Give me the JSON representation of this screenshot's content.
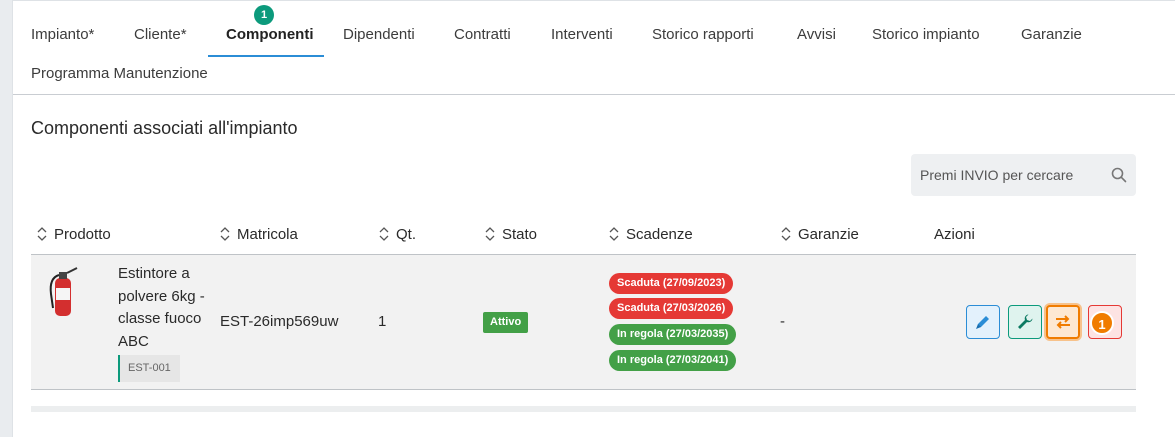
{
  "tabs": [
    {
      "label": "Impianto*"
    },
    {
      "label": "Cliente*"
    },
    {
      "label": "Componenti",
      "badge": "1"
    },
    {
      "label": "Dipendenti"
    },
    {
      "label": "Contratti"
    },
    {
      "label": "Interventi"
    },
    {
      "label": "Storico rapporti"
    },
    {
      "label": "Avvisi"
    },
    {
      "label": "Storico impianto"
    },
    {
      "label": "Garanzie"
    },
    {
      "label": "Programma Manutenzione"
    }
  ],
  "section_title": "Componenti associati all'impianto",
  "search": {
    "placeholder": "Premi INVIO per cercare"
  },
  "columns": [
    "Prodotto",
    "Matricola",
    "Qt.",
    "Stato",
    "Scadenze",
    "Garanzie",
    "Azioni"
  ],
  "rows": [
    {
      "product_name": "Estintore a polvere 6kg - classe fuoco ABC",
      "product_code": "EST-001",
      "matricola": "EST-26imp569uw",
      "qty": "1",
      "status": "Attivo",
      "scadenze": [
        {
          "text": "Scaduta (27/09/2023)",
          "color": "#e53935"
        },
        {
          "text": "Scaduta (27/03/2026)",
          "color": "#e53935"
        },
        {
          "text": "In regola (27/03/2035)",
          "color": "#43a047"
        },
        {
          "text": "In regola (27/03/2041)",
          "color": "#43a047"
        }
      ],
      "garanzie": "-",
      "actions": {
        "swap_badge": "1"
      }
    }
  ],
  "colors": {
    "accent": "#2b8dd6",
    "teal": "#0c9a7c",
    "danger": "#e53935",
    "success": "#43a047",
    "warning": "#f07c00"
  }
}
